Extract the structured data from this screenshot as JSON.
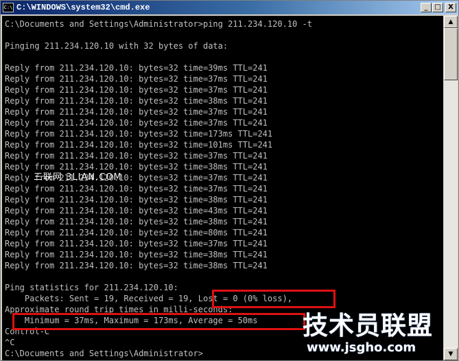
{
  "window": {
    "title": "C:\\WINDOWS\\system32\\cmd.exe",
    "icon_label": "C:\\",
    "minimize_icon": "_",
    "maximize_icon": "□",
    "close_icon": "X"
  },
  "console": {
    "lines": [
      "C:\\Documents and Settings\\Administrator>ping 211.234.120.10 -t",
      "",
      "Pinging 211.234.120.10 with 32 bytes of data:",
      "",
      "Reply from 211.234.120.10: bytes=32 time=39ms TTL=241",
      "Reply from 211.234.120.10: bytes=32 time=37ms TTL=241",
      "Reply from 211.234.120.10: bytes=32 time=37ms TTL=241",
      "Reply from 211.234.120.10: bytes=32 time=38ms TTL=241",
      "Reply from 211.234.120.10: bytes=32 time=37ms TTL=241",
      "Reply from 211.234.120.10: bytes=32 time=37ms TTL=241",
      "Reply from 211.234.120.10: bytes=32 time=173ms TTL=241",
      "Reply from 211.234.120.10: bytes=32 time=101ms TTL=241",
      "Reply from 211.234.120.10: bytes=32 time=37ms TTL=241",
      "Reply from 211.234.120.10: bytes=32 time=38ms TTL=241",
      "Reply from 211.234.120.10: bytes=32 time=37ms TTL=241",
      "Reply from 211.234.120.10: bytes=32 time=37ms TTL=241",
      "Reply from 211.234.120.10: bytes=32 time=38ms TTL=241",
      "Reply from 211.234.120.10: bytes=32 time=43ms TTL=241",
      "Reply from 211.234.120.10: bytes=32 time=38ms TTL=241",
      "Reply from 211.234.120.10: bytes=32 time=80ms TTL=241",
      "Reply from 211.234.120.10: bytes=32 time=37ms TTL=241",
      "Reply from 211.234.120.10: bytes=32 time=38ms TTL=241",
      "Reply from 211.234.120.10: bytes=32 time=38ms TTL=241",
      "",
      "Ping statistics for 211.234.120.10:",
      "    Packets: Sent = 19, Received = 19, Lost = 0 (0% loss),",
      "Approximate round trip times in milli-seconds:",
      "    Minimum = 37ms, Maximum = 173ms, Average = 50ms",
      "Control-C",
      "^C",
      "C:\\Documents and Settings\\Administrator>"
    ]
  },
  "watermarks": {
    "small": "三联网 3LIAN.COM",
    "brand": "技术员联盟",
    "url": "www.jsgho.com"
  },
  "colors": {
    "console_bg": "#000000",
    "console_text": "#c0c0c0",
    "highlight": "#e01010"
  }
}
